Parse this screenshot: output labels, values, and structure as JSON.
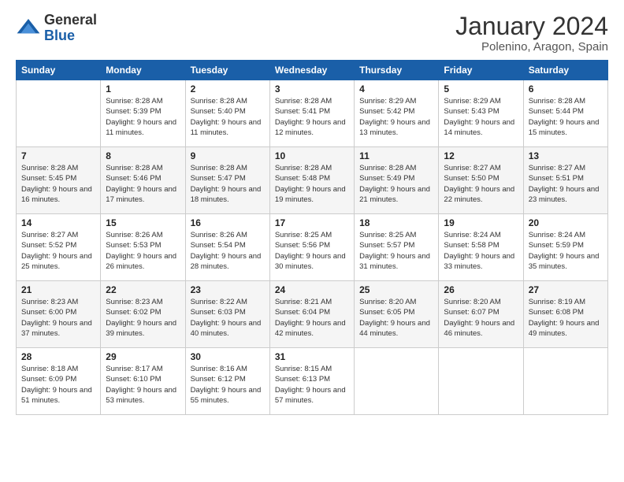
{
  "logo": {
    "general": "General",
    "blue": "Blue"
  },
  "title": "January 2024",
  "subtitle": "Polenino, Aragon, Spain",
  "weekdays": [
    "Sunday",
    "Monday",
    "Tuesday",
    "Wednesday",
    "Thursday",
    "Friday",
    "Saturday"
  ],
  "weeks": [
    [
      {
        "day": "",
        "sunrise": "",
        "sunset": "",
        "daylight": ""
      },
      {
        "day": "1",
        "sunrise": "Sunrise: 8:28 AM",
        "sunset": "Sunset: 5:39 PM",
        "daylight": "Daylight: 9 hours and 11 minutes."
      },
      {
        "day": "2",
        "sunrise": "Sunrise: 8:28 AM",
        "sunset": "Sunset: 5:40 PM",
        "daylight": "Daylight: 9 hours and 11 minutes."
      },
      {
        "day": "3",
        "sunrise": "Sunrise: 8:28 AM",
        "sunset": "Sunset: 5:41 PM",
        "daylight": "Daylight: 9 hours and 12 minutes."
      },
      {
        "day": "4",
        "sunrise": "Sunrise: 8:29 AM",
        "sunset": "Sunset: 5:42 PM",
        "daylight": "Daylight: 9 hours and 13 minutes."
      },
      {
        "day": "5",
        "sunrise": "Sunrise: 8:29 AM",
        "sunset": "Sunset: 5:43 PM",
        "daylight": "Daylight: 9 hours and 14 minutes."
      },
      {
        "day": "6",
        "sunrise": "Sunrise: 8:28 AM",
        "sunset": "Sunset: 5:44 PM",
        "daylight": "Daylight: 9 hours and 15 minutes."
      }
    ],
    [
      {
        "day": "7",
        "sunrise": "Sunrise: 8:28 AM",
        "sunset": "Sunset: 5:45 PM",
        "daylight": "Daylight: 9 hours and 16 minutes."
      },
      {
        "day": "8",
        "sunrise": "Sunrise: 8:28 AM",
        "sunset": "Sunset: 5:46 PM",
        "daylight": "Daylight: 9 hours and 17 minutes."
      },
      {
        "day": "9",
        "sunrise": "Sunrise: 8:28 AM",
        "sunset": "Sunset: 5:47 PM",
        "daylight": "Daylight: 9 hours and 18 minutes."
      },
      {
        "day": "10",
        "sunrise": "Sunrise: 8:28 AM",
        "sunset": "Sunset: 5:48 PM",
        "daylight": "Daylight: 9 hours and 19 minutes."
      },
      {
        "day": "11",
        "sunrise": "Sunrise: 8:28 AM",
        "sunset": "Sunset: 5:49 PM",
        "daylight": "Daylight: 9 hours and 21 minutes."
      },
      {
        "day": "12",
        "sunrise": "Sunrise: 8:27 AM",
        "sunset": "Sunset: 5:50 PM",
        "daylight": "Daylight: 9 hours and 22 minutes."
      },
      {
        "day": "13",
        "sunrise": "Sunrise: 8:27 AM",
        "sunset": "Sunset: 5:51 PM",
        "daylight": "Daylight: 9 hours and 23 minutes."
      }
    ],
    [
      {
        "day": "14",
        "sunrise": "Sunrise: 8:27 AM",
        "sunset": "Sunset: 5:52 PM",
        "daylight": "Daylight: 9 hours and 25 minutes."
      },
      {
        "day": "15",
        "sunrise": "Sunrise: 8:26 AM",
        "sunset": "Sunset: 5:53 PM",
        "daylight": "Daylight: 9 hours and 26 minutes."
      },
      {
        "day": "16",
        "sunrise": "Sunrise: 8:26 AM",
        "sunset": "Sunset: 5:54 PM",
        "daylight": "Daylight: 9 hours and 28 minutes."
      },
      {
        "day": "17",
        "sunrise": "Sunrise: 8:25 AM",
        "sunset": "Sunset: 5:56 PM",
        "daylight": "Daylight: 9 hours and 30 minutes."
      },
      {
        "day": "18",
        "sunrise": "Sunrise: 8:25 AM",
        "sunset": "Sunset: 5:57 PM",
        "daylight": "Daylight: 9 hours and 31 minutes."
      },
      {
        "day": "19",
        "sunrise": "Sunrise: 8:24 AM",
        "sunset": "Sunset: 5:58 PM",
        "daylight": "Daylight: 9 hours and 33 minutes."
      },
      {
        "day": "20",
        "sunrise": "Sunrise: 8:24 AM",
        "sunset": "Sunset: 5:59 PM",
        "daylight": "Daylight: 9 hours and 35 minutes."
      }
    ],
    [
      {
        "day": "21",
        "sunrise": "Sunrise: 8:23 AM",
        "sunset": "Sunset: 6:00 PM",
        "daylight": "Daylight: 9 hours and 37 minutes."
      },
      {
        "day": "22",
        "sunrise": "Sunrise: 8:23 AM",
        "sunset": "Sunset: 6:02 PM",
        "daylight": "Daylight: 9 hours and 39 minutes."
      },
      {
        "day": "23",
        "sunrise": "Sunrise: 8:22 AM",
        "sunset": "Sunset: 6:03 PM",
        "daylight": "Daylight: 9 hours and 40 minutes."
      },
      {
        "day": "24",
        "sunrise": "Sunrise: 8:21 AM",
        "sunset": "Sunset: 6:04 PM",
        "daylight": "Daylight: 9 hours and 42 minutes."
      },
      {
        "day": "25",
        "sunrise": "Sunrise: 8:20 AM",
        "sunset": "Sunset: 6:05 PM",
        "daylight": "Daylight: 9 hours and 44 minutes."
      },
      {
        "day": "26",
        "sunrise": "Sunrise: 8:20 AM",
        "sunset": "Sunset: 6:07 PM",
        "daylight": "Daylight: 9 hours and 46 minutes."
      },
      {
        "day": "27",
        "sunrise": "Sunrise: 8:19 AM",
        "sunset": "Sunset: 6:08 PM",
        "daylight": "Daylight: 9 hours and 49 minutes."
      }
    ],
    [
      {
        "day": "28",
        "sunrise": "Sunrise: 8:18 AM",
        "sunset": "Sunset: 6:09 PM",
        "daylight": "Daylight: 9 hours and 51 minutes."
      },
      {
        "day": "29",
        "sunrise": "Sunrise: 8:17 AM",
        "sunset": "Sunset: 6:10 PM",
        "daylight": "Daylight: 9 hours and 53 minutes."
      },
      {
        "day": "30",
        "sunrise": "Sunrise: 8:16 AM",
        "sunset": "Sunset: 6:12 PM",
        "daylight": "Daylight: 9 hours and 55 minutes."
      },
      {
        "day": "31",
        "sunrise": "Sunrise: 8:15 AM",
        "sunset": "Sunset: 6:13 PM",
        "daylight": "Daylight: 9 hours and 57 minutes."
      },
      {
        "day": "",
        "sunrise": "",
        "sunset": "",
        "daylight": ""
      },
      {
        "day": "",
        "sunrise": "",
        "sunset": "",
        "daylight": ""
      },
      {
        "day": "",
        "sunrise": "",
        "sunset": "",
        "daylight": ""
      }
    ]
  ]
}
